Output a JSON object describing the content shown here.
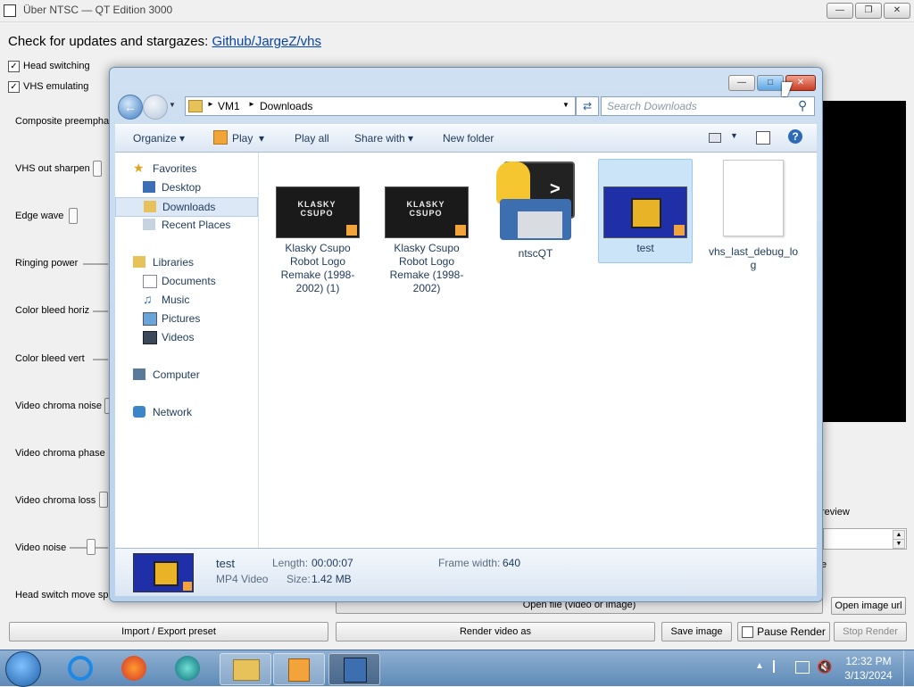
{
  "app": {
    "title": "Über NTSC — QT Edition 3000",
    "updates_text": "Check for updates and stargazes: ",
    "updates_link": "Github/JargeZ/vhs",
    "checkboxes": [
      {
        "label": "Head switching",
        "checked": true
      },
      {
        "label": "VHS emulating",
        "checked": true
      }
    ],
    "sliders": [
      "Composite preemphas",
      "VHS out sharpen",
      "Edge wave",
      "Ringing power",
      "Color bleed horiz",
      "Color bleed vert",
      "Video chroma noise",
      "Video chroma phase n",
      "Video chroma loss",
      "Video noise",
      "Head switch move spe"
    ],
    "preview_label": "review",
    "preview_suffix": "e",
    "buttons": {
      "open_file": "Open file (video or image)",
      "open_image_url": "Open image url",
      "import_export": "Import / Export preset",
      "render_video": "Render video as",
      "save_image": "Save image",
      "pause_render": "Pause Render",
      "stop_render": "Stop Render"
    }
  },
  "dialog": {
    "breadcrumb": [
      "VM1",
      "Downloads"
    ],
    "search_placeholder": "Search Downloads",
    "commands": {
      "organize": "Organize",
      "play": "Play",
      "play_all": "Play all",
      "share_with": "Share with",
      "new_folder": "New folder"
    },
    "nav": {
      "favorites": "Favorites",
      "desktop": "Desktop",
      "downloads": "Downloads",
      "recent_places": "Recent Places",
      "libraries": "Libraries",
      "documents": "Documents",
      "music": "Music",
      "pictures": "Pictures",
      "videos": "Videos",
      "computer": "Computer",
      "network": "Network"
    },
    "files": [
      {
        "name": "Klasky Csupo Robot Logo Remake (1998-2002) (1)",
        "type": "video",
        "thumb_text": "KLASKY CSUPO"
      },
      {
        "name": "Klasky Csupo Robot Logo Remake (1998-2002)",
        "type": "video",
        "thumb_text": "KLASKY CSUPO"
      },
      {
        "name": "ntscQT",
        "type": "python"
      },
      {
        "name": "test",
        "type": "video",
        "selected": true
      },
      {
        "name": "vhs_last_debug_log",
        "type": "text"
      }
    ],
    "details": {
      "name": "test",
      "type": "MP4 Video",
      "length_label": "Length:",
      "length": "00:00:07",
      "size_label": "Size:",
      "size": "1.42 MB",
      "frame_width_label": "Frame width:",
      "frame_width": "640"
    }
  },
  "taskbar": {
    "time": "12:32 PM",
    "date": "3/13/2024"
  }
}
